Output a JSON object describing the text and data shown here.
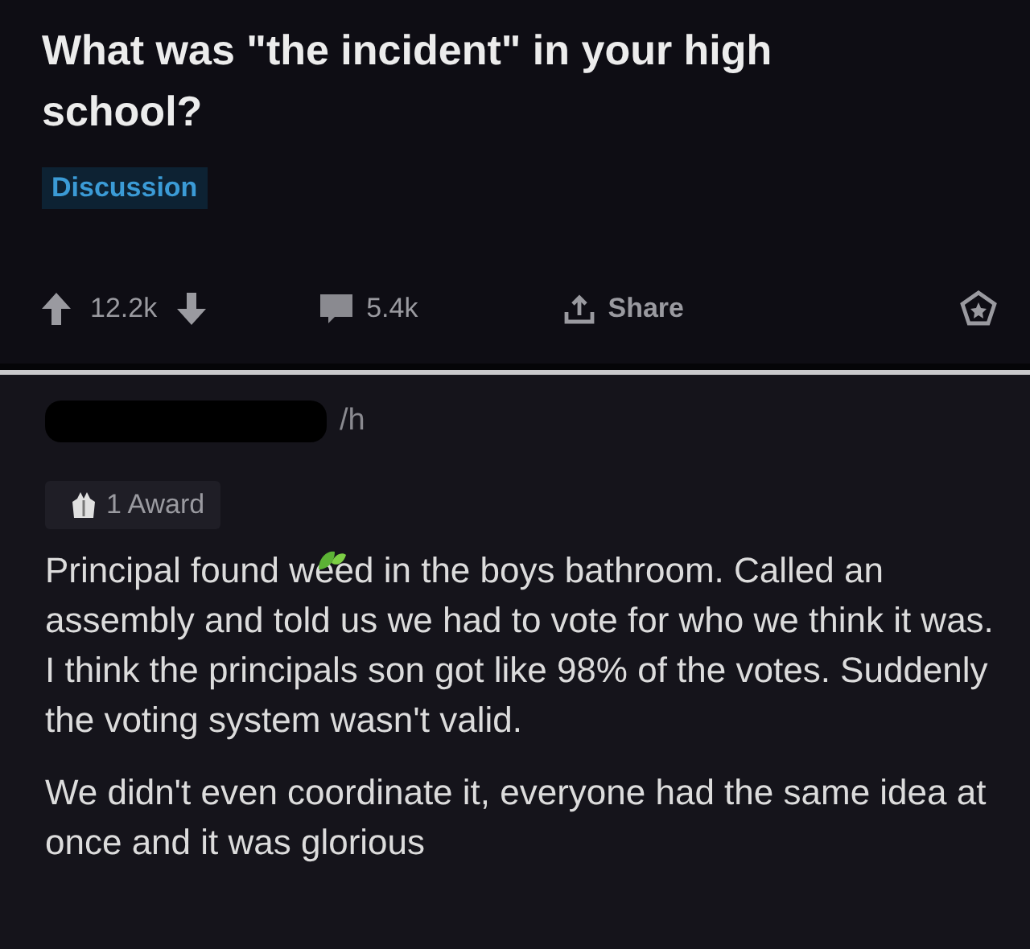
{
  "post": {
    "title": "What was \"the incident\" in your high school?",
    "flair": "Discussion",
    "score": "12.2k",
    "comments": "5.4k",
    "share": "Share"
  },
  "comment": {
    "author_redacted": true,
    "age": "/h",
    "award": "1 Award",
    "paragraphs": [
      "Principal found weed in the boys bathroom. Called an assembly and told us we had to vote for who we think it was. I think the principals son got like 98% of the votes. Suddenly the voting system wasn't valid.",
      "We didn't even coordinate it, everyone had the same idea at once and it was glorious"
    ]
  }
}
